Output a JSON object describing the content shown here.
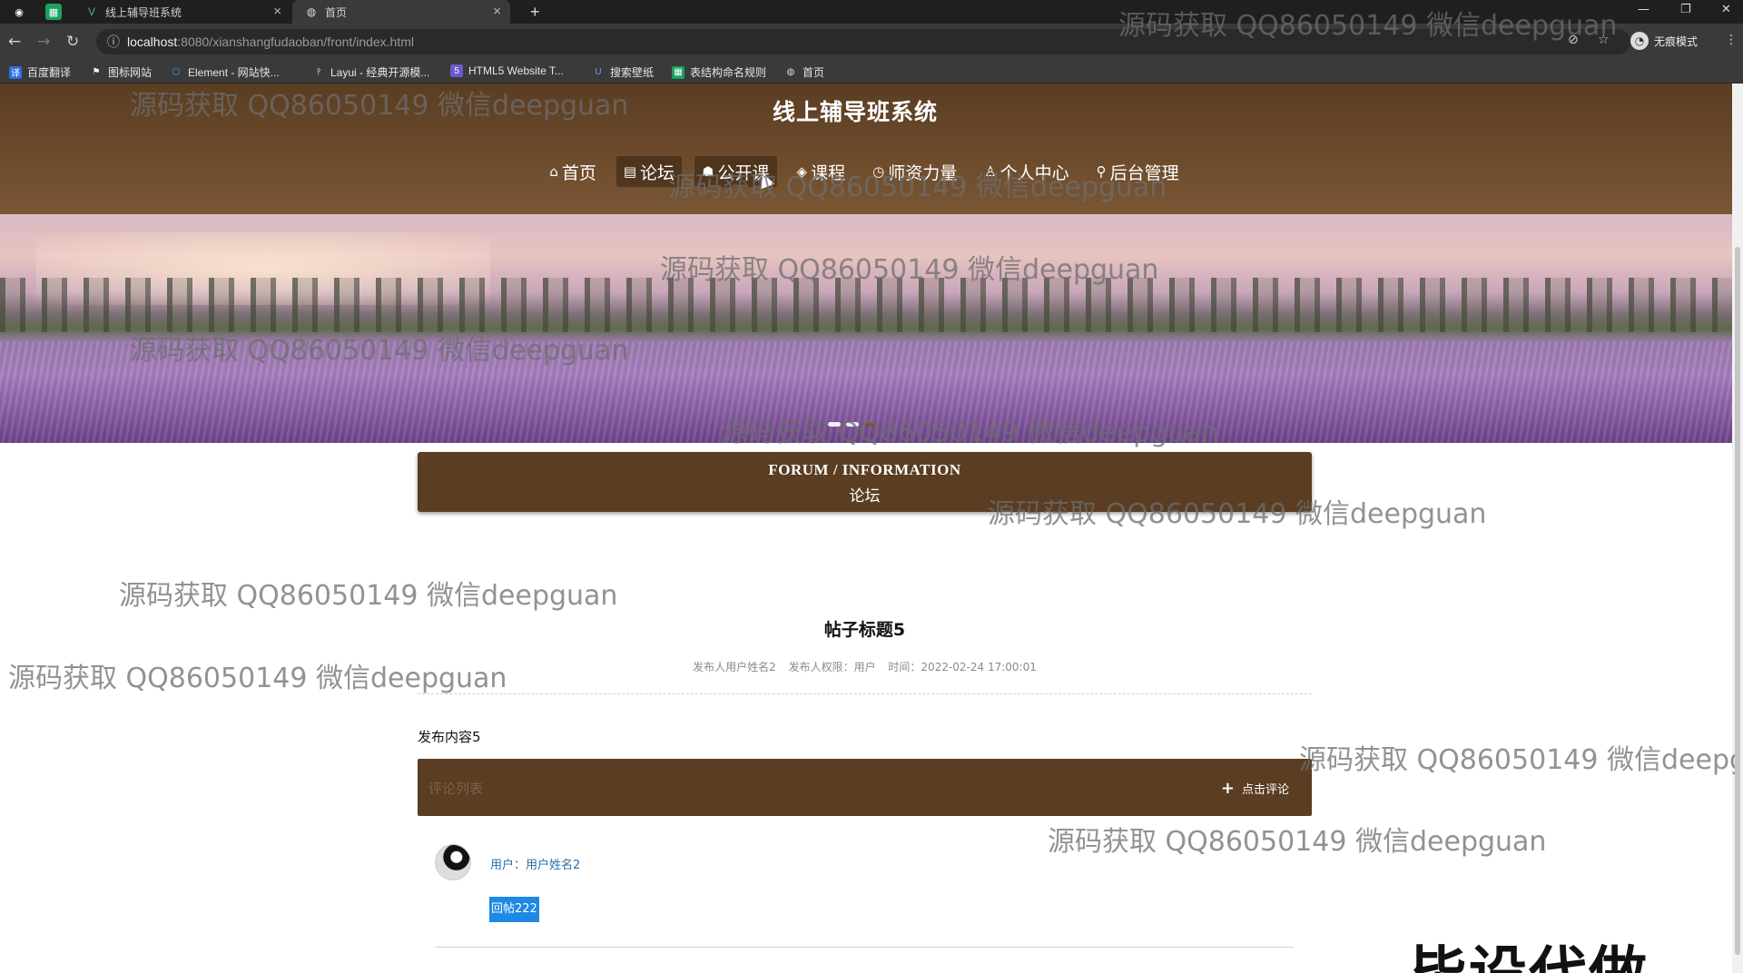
{
  "browser": {
    "tabs": [
      {
        "label": "线上辅导班系统",
        "active": false
      },
      {
        "label": "首页",
        "active": true
      }
    ],
    "new_tab": "+",
    "url_host": "localhost",
    "url_rest": ":8080/xianshangfudaoban/front/index.html",
    "profile_label": "无痕模式",
    "bookmarks": [
      {
        "label": "百度翻译",
        "icon": "translate-icon",
        "color": "#2b6de0"
      },
      {
        "label": "图标网站",
        "icon": "flag-icon",
        "color": "#444444"
      },
      {
        "label": "Element - 网站快...",
        "icon": "element-icon",
        "color": "#409eff"
      },
      {
        "label": "Layui - 经典开源模...",
        "icon": "layui-icon",
        "color": "#555555"
      },
      {
        "label": "HTML5 Website T...",
        "icon": "html5-icon",
        "color": "#6a5acd"
      },
      {
        "label": "搜索壁纸",
        "icon": "wallpaper-icon",
        "color": "#3a6fd8"
      },
      {
        "label": "表结构命名规则",
        "icon": "sheet-icon",
        "color": "#1aa15f"
      },
      {
        "label": "首页",
        "icon": "globe-icon",
        "color": "#666666"
      }
    ]
  },
  "site": {
    "title": "线上辅导班系统",
    "menu": [
      {
        "label": "首页",
        "icon": "⌂",
        "active": false
      },
      {
        "label": "论坛",
        "icon": "▤",
        "active": true
      },
      {
        "label": "公开课",
        "icon": "☗",
        "active": true
      },
      {
        "label": "课程",
        "icon": "◈",
        "active": false
      },
      {
        "label": "师资力量",
        "icon": "◷",
        "active": false
      },
      {
        "label": "个人中心",
        "icon": "♙",
        "active": false
      },
      {
        "label": "后台管理",
        "icon": "⚲",
        "active": false
      }
    ]
  },
  "section": {
    "title_en": "FORUM / INFORMATION",
    "title_zh": "论坛"
  },
  "post": {
    "title": "帖子标题5",
    "author": "发布人用户姓名2",
    "role": "发布人权限：用户",
    "time": "时间：2022-02-24 17:00:01",
    "content": "发布内容5"
  },
  "comments": {
    "header_label": "评论列表",
    "add_label": "点击评论",
    "items": [
      {
        "user": "用户：用户姓名2",
        "text": "回帖222"
      }
    ]
  },
  "overlay": {
    "watermark": "源码获取 QQ86050149 微信deepguan",
    "promo": "毕设代做"
  }
}
